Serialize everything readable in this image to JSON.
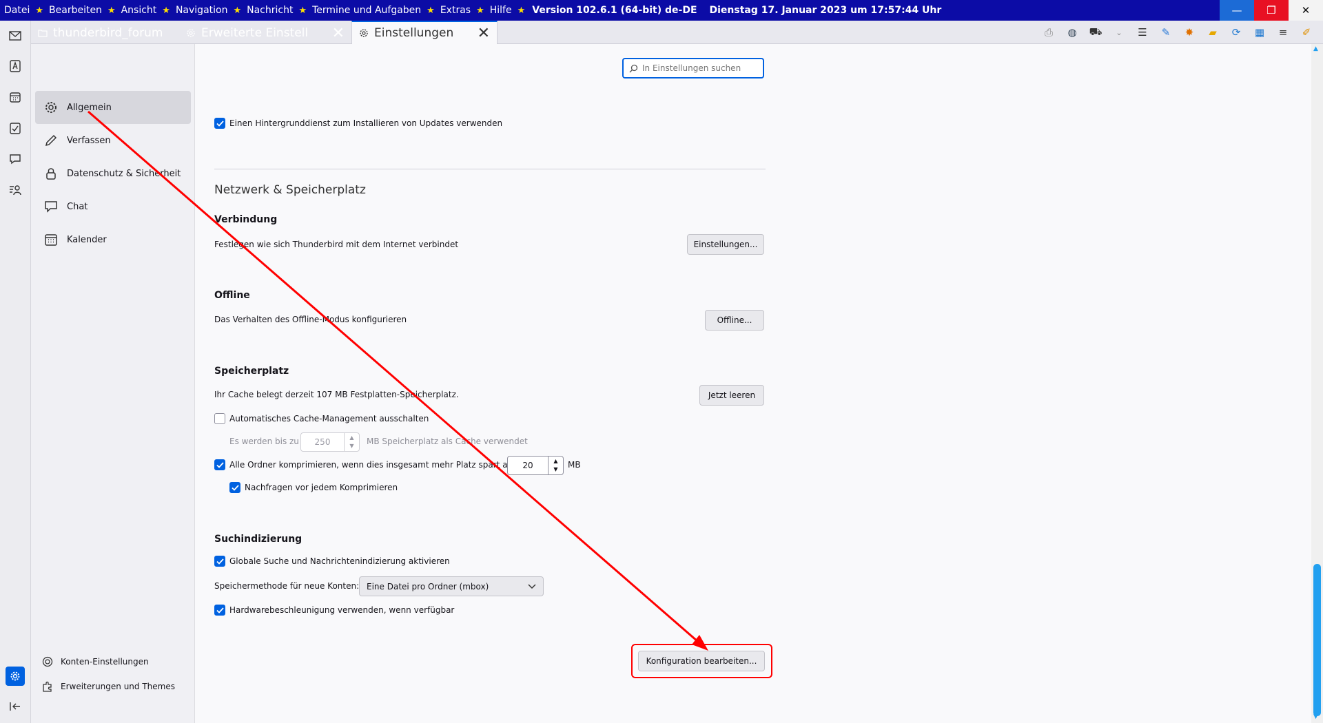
{
  "menubar": {
    "items": [
      "Datei",
      "Bearbeiten",
      "Ansicht",
      "Navigation",
      "Nachricht",
      "Termine und Aufgaben",
      "Extras",
      "Hilfe"
    ],
    "version": "Version 102.6.1 (64-bit) de-DE",
    "datetime": "Dienstag 17. Januar 2023 um  17:57:44 Uhr",
    "separator": "★"
  },
  "tabs": [
    {
      "label": "thunderbird_forum"
    },
    {
      "label": "Erweiterte Einstell"
    },
    {
      "label": "Einstellungen"
    }
  ],
  "sidebar": {
    "categories": [
      {
        "label": "Allgemein",
        "icon": "gear-icon"
      },
      {
        "label": "Verfassen",
        "icon": "pencil-icon"
      },
      {
        "label": "Datenschutz & Sicherheit",
        "icon": "lock-icon"
      },
      {
        "label": "Chat",
        "icon": "chat-icon"
      },
      {
        "label": "Kalender",
        "icon": "calendar-icon"
      }
    ],
    "footer": [
      {
        "label": "Konten-Einstellungen",
        "icon": "account-icon"
      },
      {
        "label": "Erweiterungen und Themes",
        "icon": "puzzle-icon"
      }
    ]
  },
  "search": {
    "placeholder": "In Einstellungen suchen"
  },
  "content": {
    "updates_checkbox": "Einen Hintergrunddienst zum Installieren von Updates verwenden",
    "network_heading": "Netzwerk & Speicherplatz",
    "connection": {
      "heading": "Verbindung",
      "desc": "Festlegen wie sich Thunderbird mit dem Internet verbindet",
      "button": "Einstellungen..."
    },
    "offline": {
      "heading": "Offline",
      "desc": "Das Verhalten des Offline-Modus konfigurieren",
      "button": "Offline..."
    },
    "storage": {
      "heading": "Speicherplatz",
      "desc": "Ihr Cache belegt derzeit 107 MB Festplatten-Speicherplatz.",
      "button": "Jetzt leeren",
      "cache_override": "Automatisches Cache-Management ausschalten",
      "cache_limit_prefix": "Es werden bis zu",
      "cache_limit_value": "250",
      "cache_limit_suffix": "MB Speicherplatz als Cache verwendet",
      "compact_label": "Alle Ordner komprimieren, wenn dies insgesamt mehr Platz spart als",
      "compact_value": "20",
      "compact_unit": "MB",
      "compact_ask": "Nachfragen vor jedem Komprimieren"
    },
    "indexing": {
      "heading": "Suchindizierung",
      "global_search": "Globale Suche und Nachrichtenindizierung aktivieren",
      "store_label": "Speichermethode für neue Konten:",
      "store_value": "Eine Datei pro Ordner (mbox)",
      "hw_accel": "Hardwarebeschleunigung verwenden, wenn verfügbar"
    },
    "config_button": "Konfiguration bearbeiten..."
  },
  "colors": {
    "accent": "#0061e0",
    "menubar": "#0c0ca6",
    "annotation": "#ff0000"
  }
}
